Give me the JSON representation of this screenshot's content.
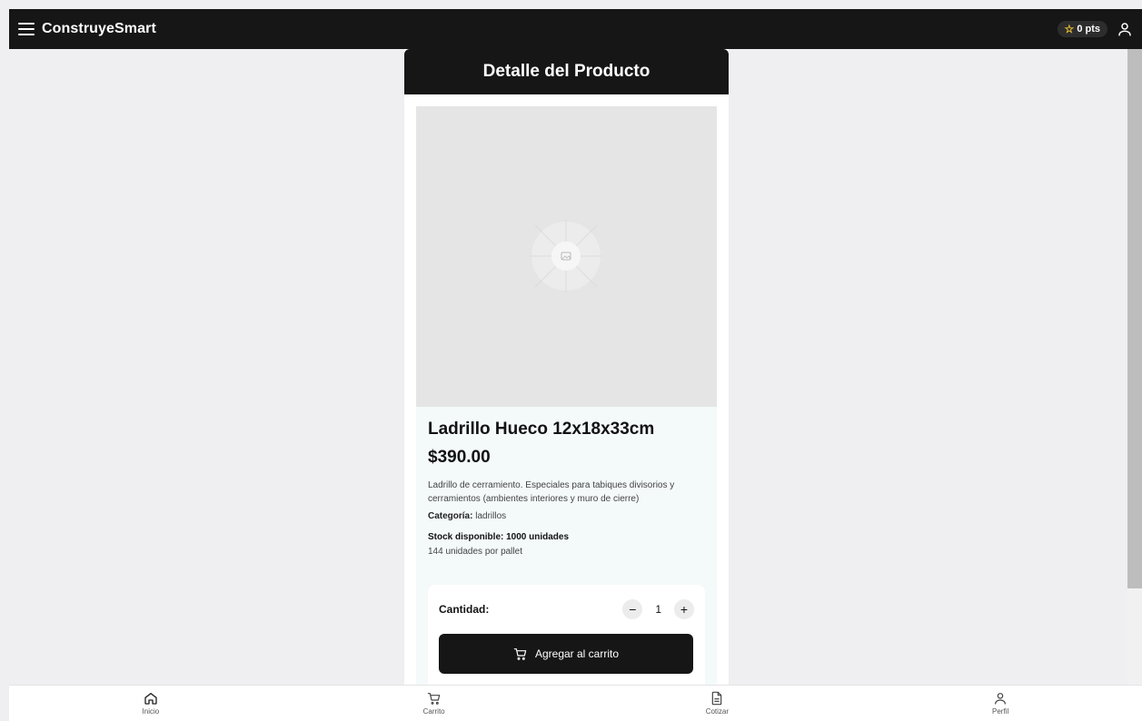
{
  "app": {
    "brand": "ConstruyeSmart",
    "points": "0 pts"
  },
  "page": {
    "title": "Detalle del Producto"
  },
  "product": {
    "name": "Ladrillo Hueco 12x18x33cm",
    "price": "$390.00",
    "description": "Ladrillo de cerramiento. Especiales para tabiques divisorios y cerramientos (ambientes interiores y muro de cierre)",
    "category_label": "Categoría:",
    "category_value": "ladrillos",
    "stock": "Stock disponible: 1000 unidades",
    "per_pallet": "144 unidades por pallet"
  },
  "quantity": {
    "label": "Cantidad:",
    "value": "1",
    "decrement": "−",
    "increment": "+"
  },
  "actions": {
    "add_to_cart": "Agregar al carrito"
  },
  "bottom_nav": {
    "items": [
      {
        "label": "Inicio",
        "icon": "home-icon"
      },
      {
        "label": "Carrito",
        "icon": "cart-icon"
      },
      {
        "label": "Cotizar",
        "icon": "document-icon"
      },
      {
        "label": "Perfil",
        "icon": "user-icon"
      }
    ]
  },
  "colors": {
    "dark": "#161616",
    "star": "#f3c530",
    "info_bg": "#f4f9f9"
  }
}
